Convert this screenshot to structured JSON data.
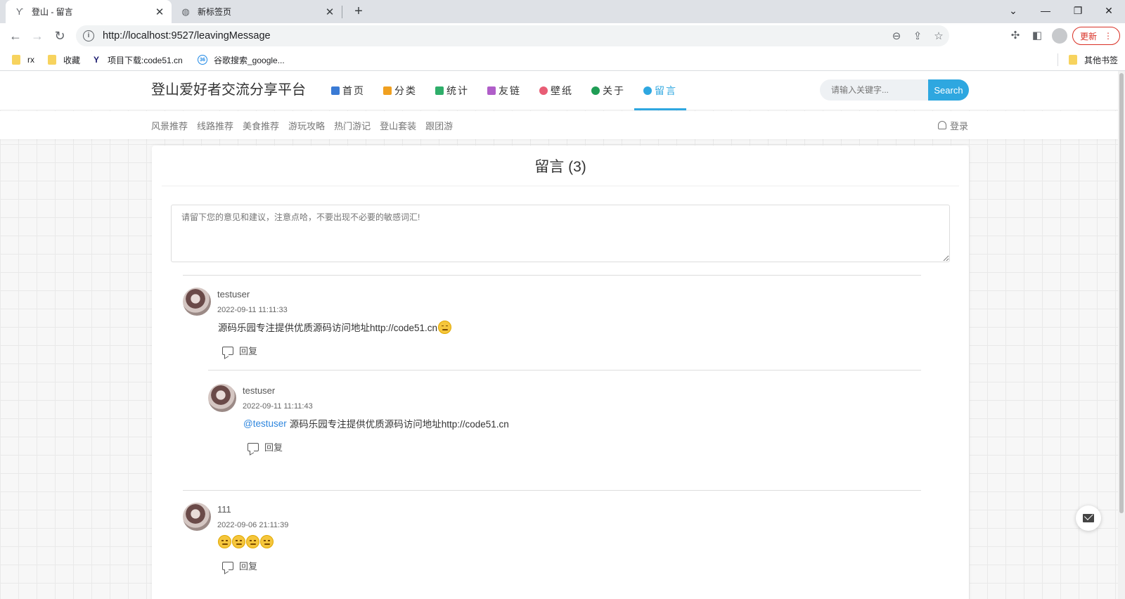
{
  "browser": {
    "tabs": [
      {
        "title": "登山 - 留言",
        "favicon": "leaf-icon",
        "active": true
      },
      {
        "title": "新标签页",
        "favicon": "globe-icon",
        "active": false
      }
    ],
    "url": "http://localhost:9527/leavingMessage",
    "update_label": "更新",
    "bookmarks": [
      {
        "label": "rx",
        "icon": "folder-icon"
      },
      {
        "label": "收藏",
        "icon": "folder-icon"
      },
      {
        "label": "项目下载:code51.cn",
        "icon": "y-logo-icon"
      },
      {
        "label": "谷歌搜索_google...",
        "icon": "360-icon"
      }
    ],
    "other_bookmarks": "其他书签"
  },
  "site": {
    "title": "登山爱好者交流分享平台",
    "nav": [
      {
        "label": "首页",
        "icon_color": "#3a7bd5"
      },
      {
        "label": "分类",
        "icon_color": "#f0a020"
      },
      {
        "label": "统计",
        "icon_color": "#2fae6a"
      },
      {
        "label": "友链",
        "icon_color": "#b05ec9"
      },
      {
        "label": "壁纸",
        "icon_color": "#e85d75"
      },
      {
        "label": "关于",
        "icon_color": "#1f9d55"
      },
      {
        "label": "留言",
        "icon_color": "#2ea7e0",
        "active": true
      }
    ],
    "search": {
      "placeholder": "请输入关键字...",
      "button": "Search"
    },
    "subnav": [
      "风景推荐",
      "线路推荐",
      "美食推荐",
      "游玩攻略",
      "热门游记",
      "登山套装",
      "跟团游"
    ],
    "login": "登录"
  },
  "message_board": {
    "title": "留言 (3)",
    "textarea_placeholder": "请留下您的意见和建议，注意点哈，不要出现不必要的敏感词汇!",
    "reply_label": "回复",
    "comments": [
      {
        "user": "testuser",
        "time": "2022-09-11 11:11:33",
        "text": "源码乐园专注提供优质源码访问地址http://code51.cn",
        "emoji_count": 1
      },
      {
        "user": "testuser",
        "time": "2022-09-11 11:11:43",
        "mention": "@testuser",
        "text": "源码乐园专注提供优质源码访问地址http://code51.cn",
        "emoji_count": 0
      },
      {
        "user": "111",
        "time": "2022-09-06 21:11:39",
        "text": "",
        "emoji_count": 4
      }
    ]
  }
}
